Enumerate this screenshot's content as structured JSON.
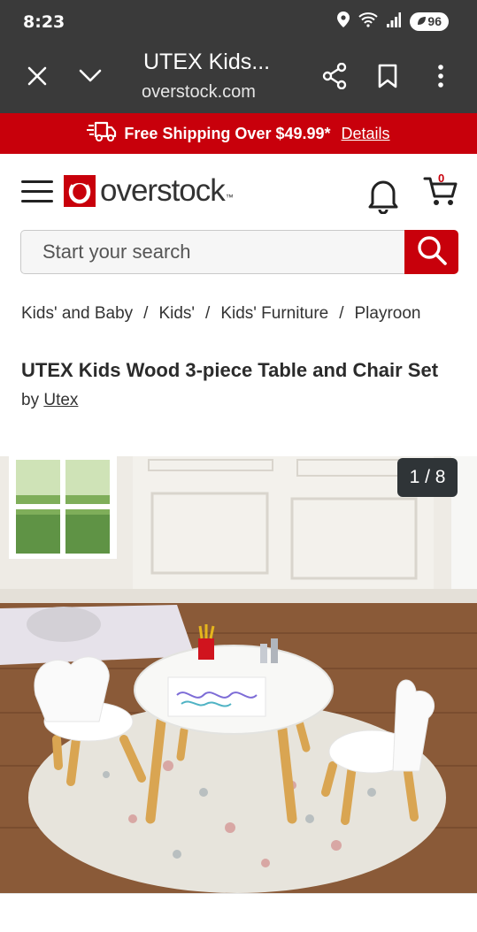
{
  "status_bar": {
    "time": "8:23",
    "battery": "96"
  },
  "browser": {
    "title": "UTEX Kids...",
    "url": "overstock.com"
  },
  "promo": {
    "text": "Free Shipping Over $49.99*",
    "link": "Details"
  },
  "header": {
    "logo": "overstock",
    "cart_count": "0"
  },
  "search": {
    "placeholder": "Start your search"
  },
  "breadcrumb": [
    "Kids' and Baby",
    "Kids'",
    "Kids' Furniture",
    "Playroon"
  ],
  "product": {
    "title": "UTEX Kids Wood 3-piece Table and Chair Set",
    "by_prefix": "by",
    "brand": "Utex"
  },
  "gallery": {
    "counter": "1 / 8"
  },
  "colors": {
    "brand_red": "#c8000b",
    "toolbar": "#3a3a3a",
    "counter_bg": "#2f3437"
  }
}
